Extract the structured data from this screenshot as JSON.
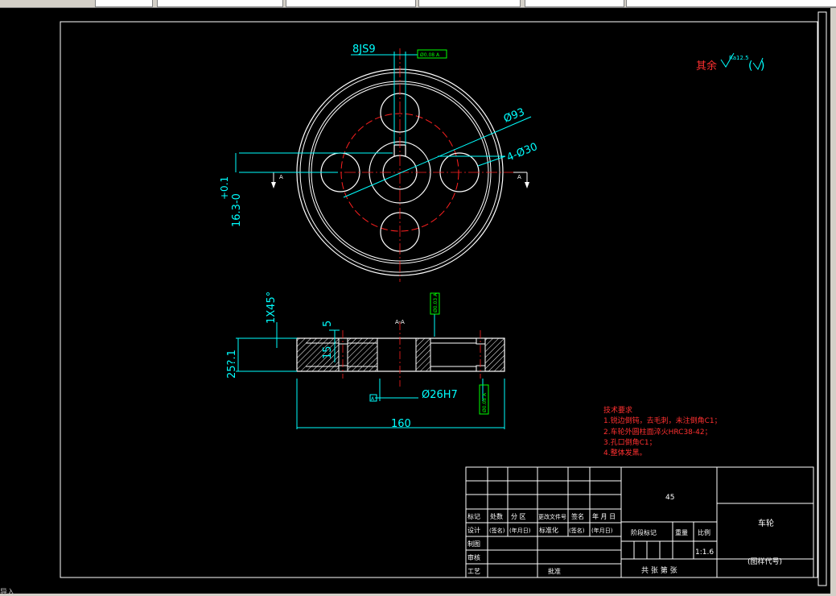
{
  "toolbar": {
    "tabs": [
      "",
      "",
      "",
      "",
      "",
      ""
    ]
  },
  "drawing": {
    "dims": {
      "keyway": "8JS9",
      "pitch_circle": "Ø93",
      "holes": "4-Ø30",
      "depth_tol_top": "+0.1",
      "depth_tol_val": "16.3-0",
      "chamfer": "1X45°",
      "web": "5",
      "hub": "15",
      "height": "25?.1",
      "bore": "Ø26H7",
      "width": "160",
      "tol_a": "Ø0.08 A",
      "tol_b": "Ø0.03 A",
      "tol_c": "Ø0.08 A"
    },
    "section_a_left": "A",
    "section_a_right": "A",
    "section_label": "A-A",
    "datum": "A",
    "surface_note_prefix": "其余",
    "surface_note_ra": "Ra12.5"
  },
  "notes": {
    "title": "技术要求",
    "items": [
      "1.锐边倒钝，去毛刺，未注倒角C1；",
      "2.车轮外圆柱面淬火HRC38-42；",
      "3.孔口倒角C1；",
      "4.整体发黑。"
    ]
  },
  "title_block": {
    "material": "45",
    "part_name": "车轮",
    "drawing_no": "(图样代号)",
    "scale": "1:1.6",
    "header_row": [
      "标记",
      "处数",
      "分 区",
      "更改文件号",
      "签名",
      "年 月 日"
    ],
    "design_row": [
      "设计",
      "(签名)",
      "(年月日)",
      "标准化",
      "(签名)",
      "(年月日)"
    ],
    "rows": [
      "制图",
      "审核",
      "工艺"
    ],
    "approve": "批准",
    "stage_mark": "阶段标记",
    "weight": "重量",
    "scale_label": "比例",
    "sheets": "共 张 第 张"
  },
  "status": {
    "command": "导入"
  }
}
